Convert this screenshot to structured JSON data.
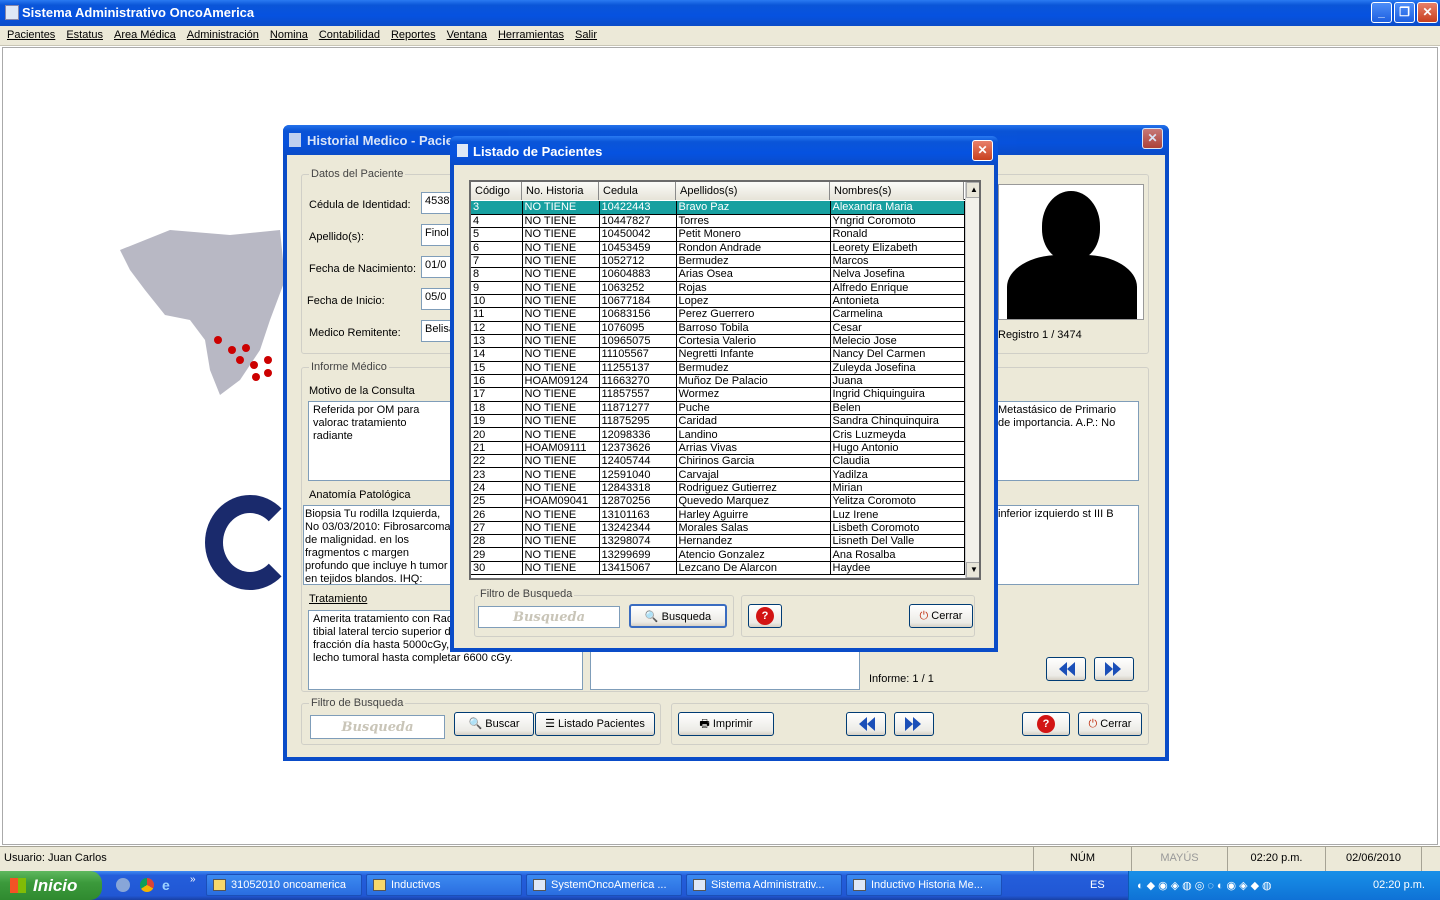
{
  "app_title": "Sistema Administrativo OncoAmerica",
  "menu": [
    "Pacientes",
    "Estatus",
    "Area Médica",
    "Administración",
    "Nomina",
    "Contabilidad",
    "Reportes",
    "Ventana",
    "Herramientas",
    "Salir"
  ],
  "historial": {
    "title": "Historial Medico - Pacie",
    "datos_label": "Datos del Paciente",
    "cedula_label": "Cédula de Identidad:",
    "cedula_value": "4538",
    "apellidos_label": "Apellido(s):",
    "apellidos_value": "Finol",
    "fecha_nac_label": "Fecha de Nacimiento:",
    "fecha_nac_value": "01/0",
    "fecha_inicio_label": "Fecha de Inicio:",
    "fecha_inicio_value": "05/0",
    "medico_label": "Medico Remitente:",
    "medico_value": "Belisa",
    "registro": "Registro 1 / 3474",
    "informe_label": "Informe Médico",
    "motivo_label": "Motivo de la Consulta",
    "motivo_left": "Referida por OM para valorac tratamiento radiante",
    "motivo_right": "Metastásico de Primario de importancia. A.P.: No",
    "anatomia_label": "Anatomía Patológica",
    "anatomia_left": "Biopsia Tu rodilla Izquierda, No 03/03/2010: Fibrosarcoma de malignidad. en los fragmentos c margen profundo que incluye h tumor en tejidos blandos.  IHQ:",
    "anatomia_right": "inferior izquierdo st III B",
    "tratamiento_label": "Tratamiento",
    "tratamiento_text": "Amerita tratamiento con Radi región de meseta tibial lateral tercio superior de peroné izqu cGy fracción día hasta 5000cGy, luego reducción a lecho tumoral hasta completar 6600 cGy.",
    "informe_count": "Informe: 1 / 1",
    "filtro_label": "Filtro de Busqueda",
    "filtro_placeholder": "Busqueda",
    "buscar_label": "Buscar",
    "listado_label": "Listado Pacientes",
    "imprimir_label": "Imprimir",
    "cerrar_label": "Cerrar"
  },
  "listado": {
    "title": "Listado de Pacientes",
    "columns": [
      "Código",
      "No. Historia",
      "Cedula",
      "Apellidos(s)",
      "Nombres(s)"
    ],
    "rows": [
      [
        "3",
        "NO TIENE",
        "10422443",
        "Bravo Paz",
        "Alexandra Maria"
      ],
      [
        "4",
        "NO TIENE",
        "10447827",
        "Torres",
        "Yngrid  Coromoto"
      ],
      [
        "5",
        "NO TIENE",
        "10450042",
        "Petit Monero",
        "Ronald"
      ],
      [
        "6",
        "NO TIENE",
        "10453459",
        "Rondon Andrade",
        "Leorety Elizabeth"
      ],
      [
        "7",
        "NO TIENE",
        "1052712",
        "Bermudez",
        "Marcos"
      ],
      [
        "8",
        "NO TIENE",
        "10604883",
        "Arias Osea",
        "Nelva Josefina"
      ],
      [
        "9",
        "NO TIENE",
        "1063252",
        "Rojas",
        "Alfredo Enrique"
      ],
      [
        "10",
        "NO TIENE",
        "10677184",
        "Lopez",
        "Antonieta"
      ],
      [
        "11",
        "NO TIENE",
        "10683156",
        "Perez Guerrero",
        "Carmelina"
      ],
      [
        "12",
        "NO TIENE",
        "1076095",
        "Barroso Tobila",
        "Cesar"
      ],
      [
        "13",
        "NO TIENE",
        "10965075",
        "Cortesia  Valerio",
        "Melecio Jose"
      ],
      [
        "14",
        "NO TIENE",
        "11105567",
        "Negretti Infante",
        "Nancy Del Carmen"
      ],
      [
        "15",
        "NO TIENE",
        "11255137",
        "Bermudez",
        "Zuleyda Josefina"
      ],
      [
        "16",
        "HOAM09124",
        "11663270",
        "Muñoz De Palacio",
        "Juana"
      ],
      [
        "17",
        "NO TIENE",
        "11857557",
        "Wormez",
        "Ingrid Chiquinguira"
      ],
      [
        "18",
        "NO TIENE",
        "11871277",
        "Puche",
        "Belen"
      ],
      [
        "19",
        "NO TIENE",
        "11875295",
        "Caridad",
        "Sandra Chinquinquira"
      ],
      [
        "20",
        "NO TIENE",
        "12098336",
        "Landino",
        "Cris Luzmeyda"
      ],
      [
        "21",
        "HOAM09111",
        "12373626",
        "Arrias Vivas",
        "Hugo Antonio"
      ],
      [
        "22",
        "NO TIENE",
        "12405744",
        "Chirinos Garcia",
        "Claudia"
      ],
      [
        "23",
        "NO TIENE",
        "12591040",
        "Carvajal",
        "Yadilza"
      ],
      [
        "24",
        "NO TIENE",
        "12843318",
        "Rodriguez Gutierrez",
        "Mirian"
      ],
      [
        "25",
        "HOAM09041",
        "12870256",
        "Quevedo Marquez",
        "Yelitza Coromoto"
      ],
      [
        "26",
        "NO TIENE",
        "13101163",
        "Harley Aguirre",
        "Luz Irene"
      ],
      [
        "27",
        "NO TIENE",
        "13242344",
        "Morales Salas",
        "Lisbeth Coromoto"
      ],
      [
        "28",
        "NO TIENE",
        "13298074",
        "Hernandez",
        "Lisneth Del Valle"
      ],
      [
        "29",
        "NO TIENE",
        "13299699",
        "Atencio Gonzalez",
        "Ana Rosalba"
      ],
      [
        "30",
        "NO TIENE",
        "13415067",
        "Lezcano De Alarcon",
        "Haydee"
      ]
    ],
    "filtro_label": "Filtro de Busqueda",
    "filtro_placeholder": "Busqueda",
    "busqueda_btn": "Busqueda",
    "cerrar_label": "Cerrar"
  },
  "status": {
    "usuario": "Usuario: Juan Carlos",
    "num": "NÚM",
    "mayus": "MAYÚS",
    "hora": "02:20 p.m.",
    "fecha": "02/06/2010"
  },
  "taskbar": {
    "start": "Inicio",
    "items": [
      "31052010 oncoamerica",
      "Inductivos",
      "SystemOncoAmerica ...",
      "Sistema Administrativ...",
      "Inductivo Historia Me..."
    ],
    "lang": "ES",
    "clock": "02:20 p.m."
  }
}
